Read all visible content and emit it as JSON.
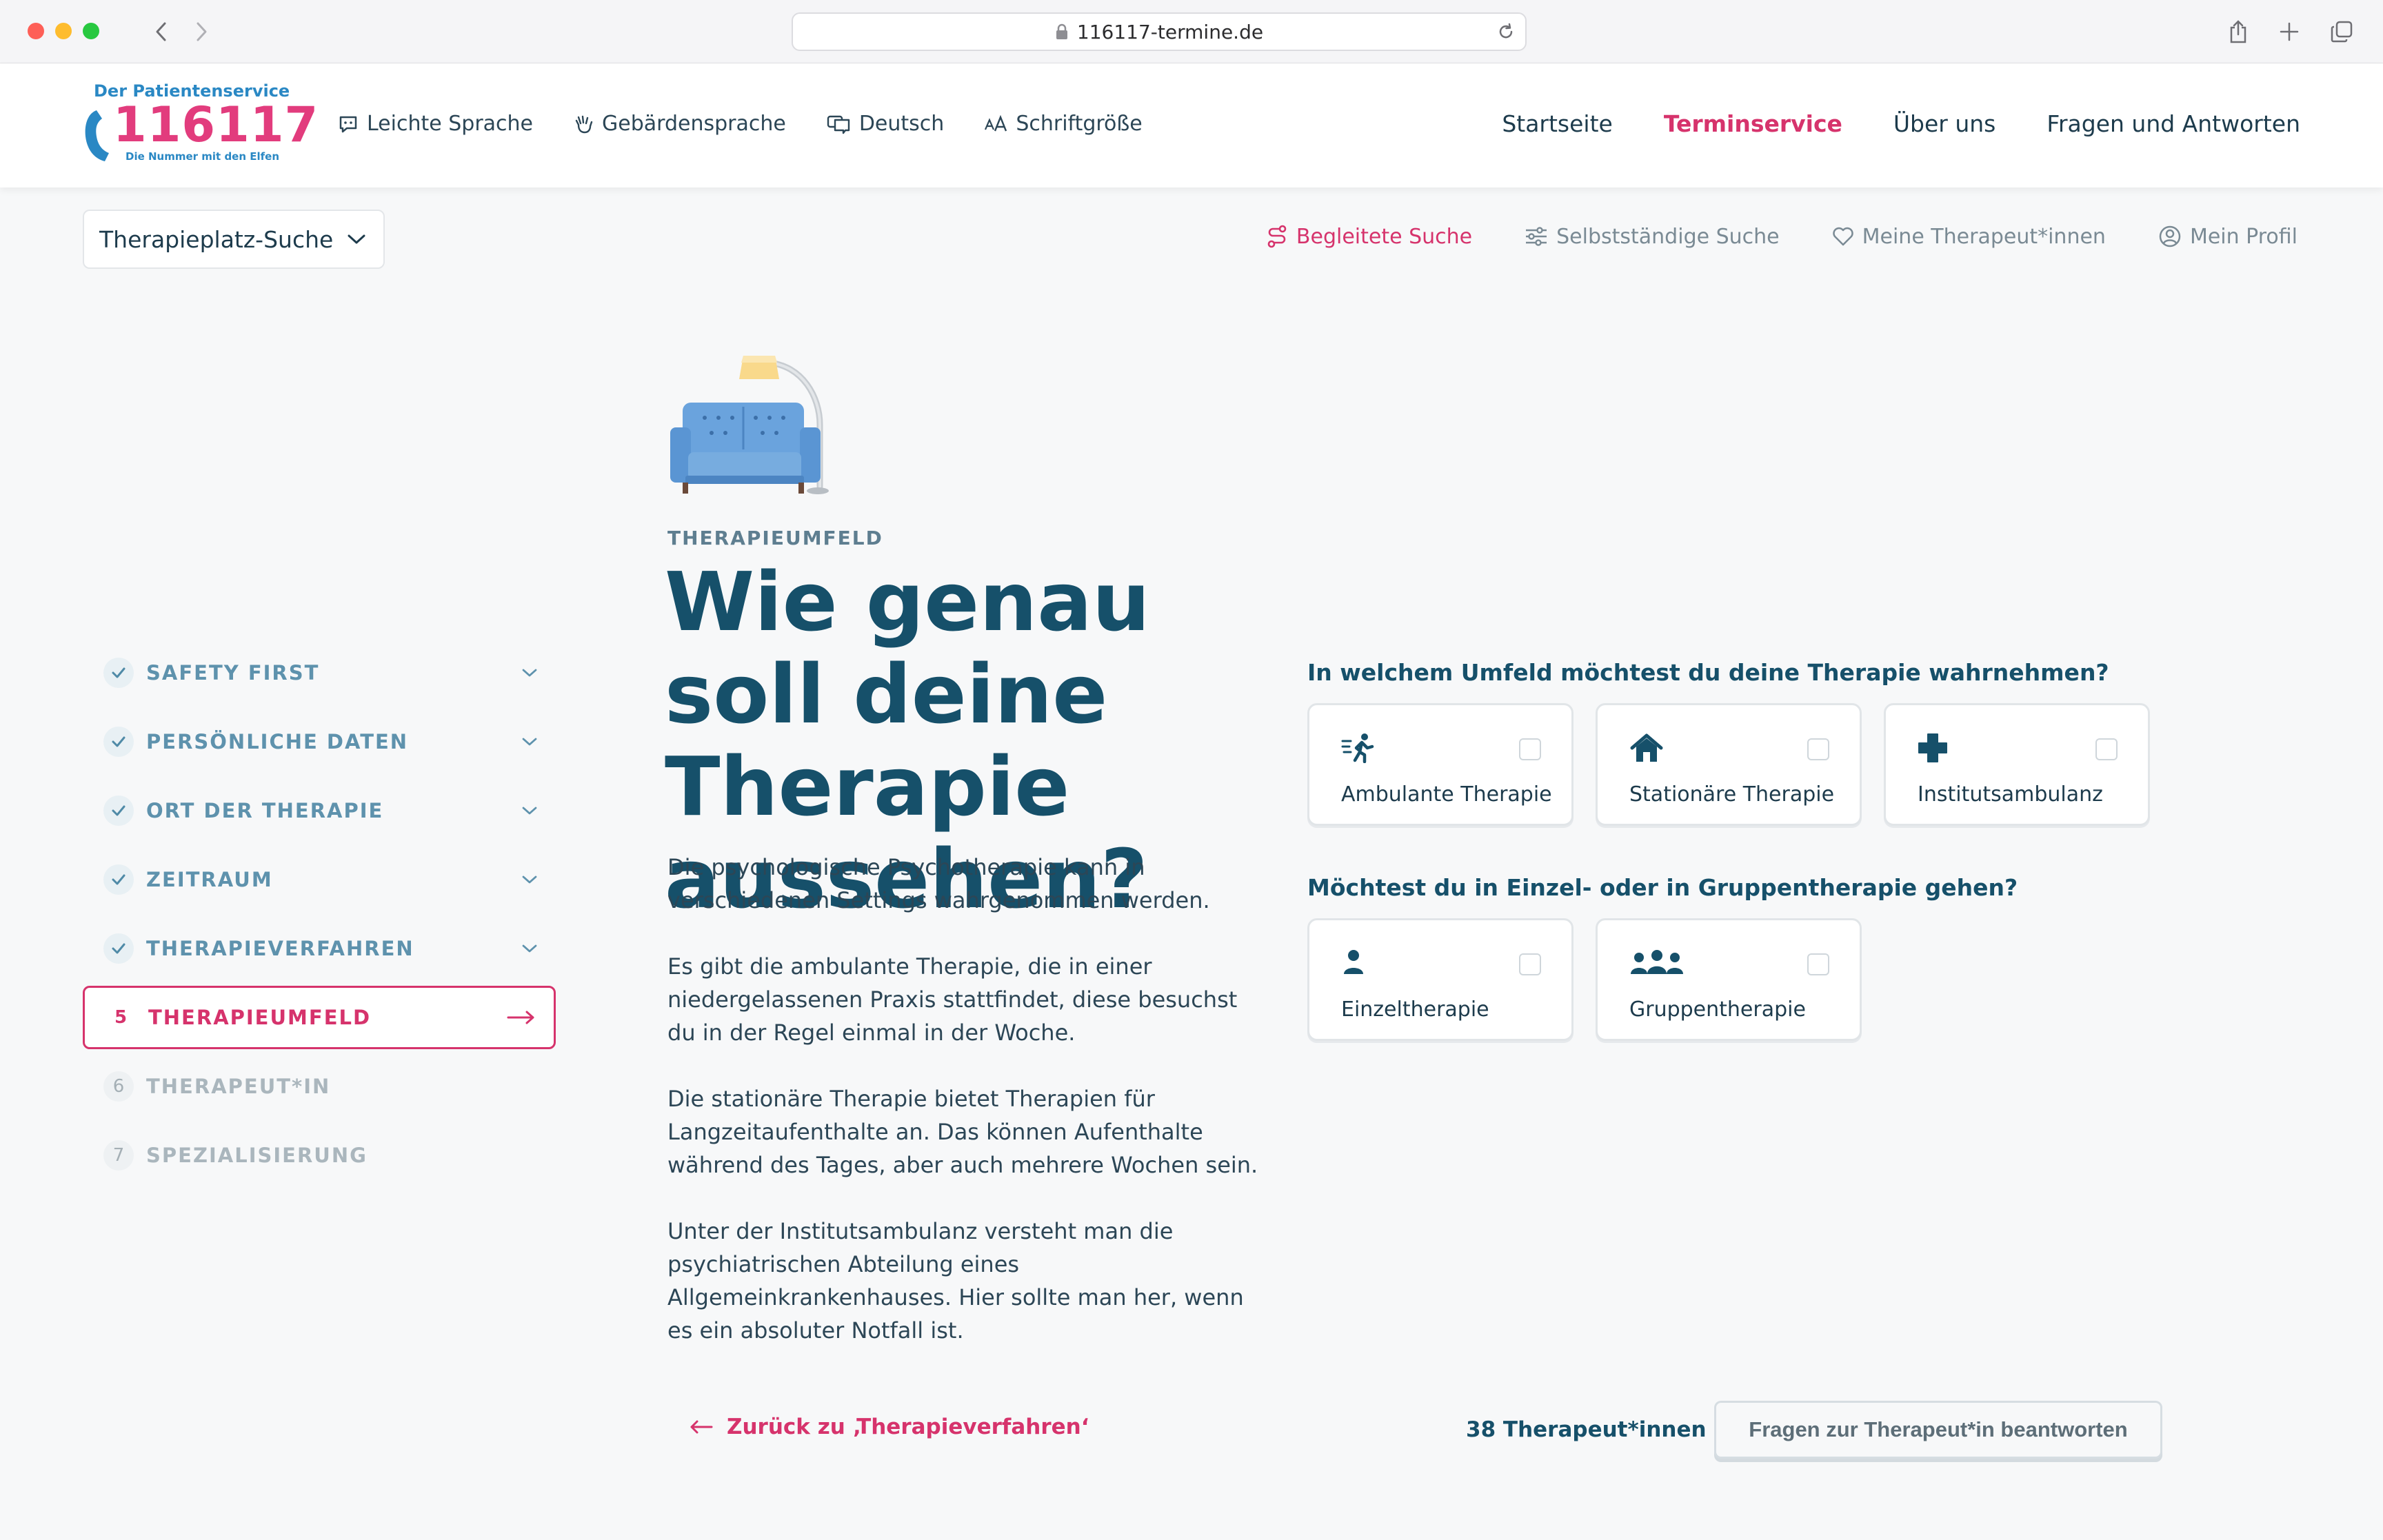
{
  "browser": {
    "url": "116117-termine.de"
  },
  "header": {
    "logo": {
      "tagline": "Der Patientenservice",
      "number": "116117",
      "subline": "Die Nummer mit den Elfen"
    },
    "util_nav": [
      {
        "label": "Leichte Sprache",
        "icon": "speech-bubble-icon"
      },
      {
        "label": "Gebärdensprache",
        "icon": "hand-icon"
      },
      {
        "label": "Deutsch",
        "icon": "language-icon"
      },
      {
        "label": "Schriftgröße",
        "icon": "font-size-icon"
      }
    ],
    "main_nav": [
      {
        "label": "Startseite"
      },
      {
        "label": "Terminservice"
      },
      {
        "label": "Über uns"
      },
      {
        "label": "Fragen und Antworten"
      }
    ]
  },
  "subbar": {
    "mode_select": "Therapieplatz-Suche",
    "tabs": [
      {
        "label": "Begleitete Suche",
        "icon": "route-icon"
      },
      {
        "label": "Selbstständige Suche",
        "icon": "sliders-icon"
      },
      {
        "label": "Meine Therapeut*innen",
        "icon": "heart-icon"
      },
      {
        "label": "Mein Profil",
        "icon": "user-circle-icon"
      }
    ]
  },
  "steps": [
    {
      "label": "SAFETY FIRST",
      "state": "done"
    },
    {
      "label": "PERSÖNLICHE DATEN",
      "state": "done"
    },
    {
      "label": "ORT DER THERAPIE",
      "state": "done"
    },
    {
      "label": "ZEITRAUM",
      "state": "done"
    },
    {
      "label": "THERAPIEVERFAHREN",
      "state": "done"
    },
    {
      "number": "5",
      "label": "THERAPIEUMFELD",
      "state": "active"
    },
    {
      "number": "6",
      "label": "THERAPEUT*IN",
      "state": "todo"
    },
    {
      "number": "7",
      "label": "SPEZIALISIERUNG",
      "state": "todo"
    }
  ],
  "main": {
    "eyebrow": "THERAPIEUMFELD",
    "headline": "Wie genau soll deine Therapie aussehen?",
    "paragraphs": [
      "Die psychologische Psychotherapie kann in verschiedenen Settings wahrgenommen werden.",
      "Es gibt die ambulante Therapie, die in einer niedergelassenen Praxis stattfindet, diese besuchst du in der Regel einmal in der Woche.",
      "Die stationäre Therapie bietet Therapien für Langzeitaufenthalte an. Das können Aufenthalte während des Tages, aber auch mehrere Wochen sein.",
      "Unter der Institutsambulanz versteht man die psychiatrischen Abteilung  eines Allgemeinkrankenhauses. Hier sollte man her, wenn es ein absoluter Notfall ist."
    ]
  },
  "questions": [
    {
      "text": "In welchem Umfeld möchtest du deine Therapie wahrnehmen?",
      "options": [
        {
          "label": "Ambulante Therapie",
          "icon": "walking-person-icon",
          "checked": false
        },
        {
          "label": "Stationäre Therapie",
          "icon": "house-icon",
          "checked": false
        },
        {
          "label": "Institutsambulanz",
          "icon": "medical-cross-icon",
          "checked": false
        }
      ]
    },
    {
      "text": "Möchtest du in Einzel- oder in Gruppentherapie gehen?",
      "options": [
        {
          "label": "Einzeltherapie",
          "icon": "person-icon",
          "checked": false
        },
        {
          "label": "Gruppentherapie",
          "icon": "group-icon",
          "checked": false
        }
      ]
    }
  ],
  "footer": {
    "back_label": "Zurück zu ‚Therapieverfahren‘",
    "count_label": "38 Therapeut*innen",
    "next_label": "Fragen zur Therapeut*in beantworten"
  },
  "colors": {
    "accent": "#d6336c",
    "primary_text": "#16506a",
    "step_done": "#5e92ad"
  }
}
